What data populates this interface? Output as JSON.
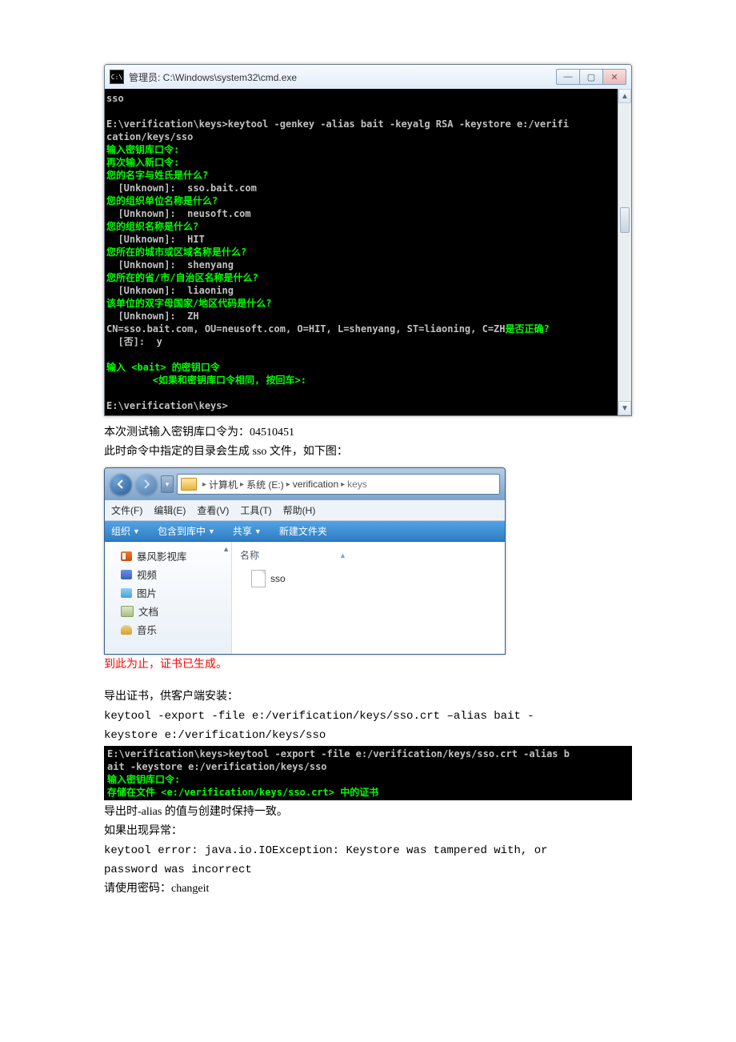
{
  "cmd": {
    "title": "管理员: C:\\Windows\\system32\\cmd.exe",
    "lines": [
      {
        "c": "gray",
        "t": "sso"
      },
      {
        "c": "gray",
        "t": ""
      },
      {
        "c": "gray",
        "t": "E:\\verification\\keys>keytool -genkey -alias bait -keyalg RSA -keystore e:/verifi"
      },
      {
        "c": "gray",
        "t": "cation/keys/sso"
      },
      {
        "c": "lime",
        "t": "输入密钥库口令:"
      },
      {
        "c": "lime",
        "t": "再次输入新口令:"
      },
      {
        "c": "lime",
        "t": "您的名字与姓氏是什么?"
      },
      {
        "c": "gray",
        "t": "  [Unknown]:  sso.bait.com"
      },
      {
        "c": "lime",
        "t": "您的组织单位名称是什么?"
      },
      {
        "c": "gray",
        "t": "  [Unknown]:  neusoft.com"
      },
      {
        "c": "lime",
        "t": "您的组织名称是什么?"
      },
      {
        "c": "gray",
        "t": "  [Unknown]:  HIT"
      },
      {
        "c": "lime",
        "t": "您所在的城市或区域名称是什么?"
      },
      {
        "c": "gray",
        "t": "  [Unknown]:  shenyang"
      },
      {
        "c": "lime",
        "t": "您所在的省/市/自治区名称是什么?"
      },
      {
        "c": "gray",
        "t": "  [Unknown]:  liaoning"
      },
      {
        "c": "lime",
        "t": "该单位的双字母国家/地区代码是什么?"
      },
      {
        "c": "gray",
        "t": "  [Unknown]:  ZH"
      },
      {
        "c": "mix",
        "parts": [
          {
            "c": "gray",
            "t": "CN=sso.bait.com, OU=neusoft.com, O=HIT, L=shenyang, ST=liaoning, C=ZH"
          },
          {
            "c": "lime",
            "t": "是否正确?"
          }
        ]
      },
      {
        "c": "gray",
        "t": "  [否]:  y"
      },
      {
        "c": "gray",
        "t": ""
      },
      {
        "c": "lime",
        "t": "输入 <bait> 的密钥口令"
      },
      {
        "c": "lime",
        "t": "        <如果和密钥库口令相同, 按回车>:"
      },
      {
        "c": "gray",
        "t": ""
      },
      {
        "c": "gray",
        "t": "E:\\verification\\keys>"
      }
    ]
  },
  "text": {
    "p1": "本次测试输入密钥库口令为：04510451",
    "p2": "此时命令中指定的目录会生成 sso 文件，如下图：",
    "red": "到此为止，证书已生成。",
    "p3": "导出证书，供客户端安装：",
    "cmd1": "keytool -export -file e:/verification/keys/sso.crt –alias bait -",
    "cmd2": "keystore e:/verification/keys/sso",
    "p4": "导出时-alias 的值与创建时保持一致。",
    "p5": "如果出现异常：",
    "err1": "keytool error: java.io.IOException: Keystore was tampered with, or",
    "err2": "password was incorrect",
    "p6": "请使用密码：changeit"
  },
  "explorer": {
    "crumbs": [
      "计算机",
      "系统 (E:)",
      "verification",
      "keys"
    ],
    "menu": {
      "file": "文件(F)",
      "edit": "编辑(E)",
      "view": "查看(V)",
      "tools": "工具(T)",
      "help": "帮助(H)"
    },
    "toolbar": {
      "org": "组织",
      "lib": "包含到库中",
      "share": "共享",
      "newf": "新建文件夹"
    },
    "nav": {
      "storm": "暴风影视库",
      "video": "视频",
      "pic": "图片",
      "doc": "文档",
      "music": "音乐"
    },
    "content": {
      "col_name": "名称",
      "file": "sso"
    }
  },
  "mini_term": {
    "lines": [
      {
        "c": "gray",
        "t": "E:\\verification\\keys>keytool -export -file e:/verification/keys/sso.crt -alias b"
      },
      {
        "c": "gray",
        "t": "ait -keystore e:/verification/keys/sso"
      },
      {
        "c": "lime",
        "t": "输入密钥库口令:"
      },
      {
        "c": "lime",
        "t": "存储在文件 <e:/verification/keys/sso.crt> 中的证书"
      }
    ]
  }
}
